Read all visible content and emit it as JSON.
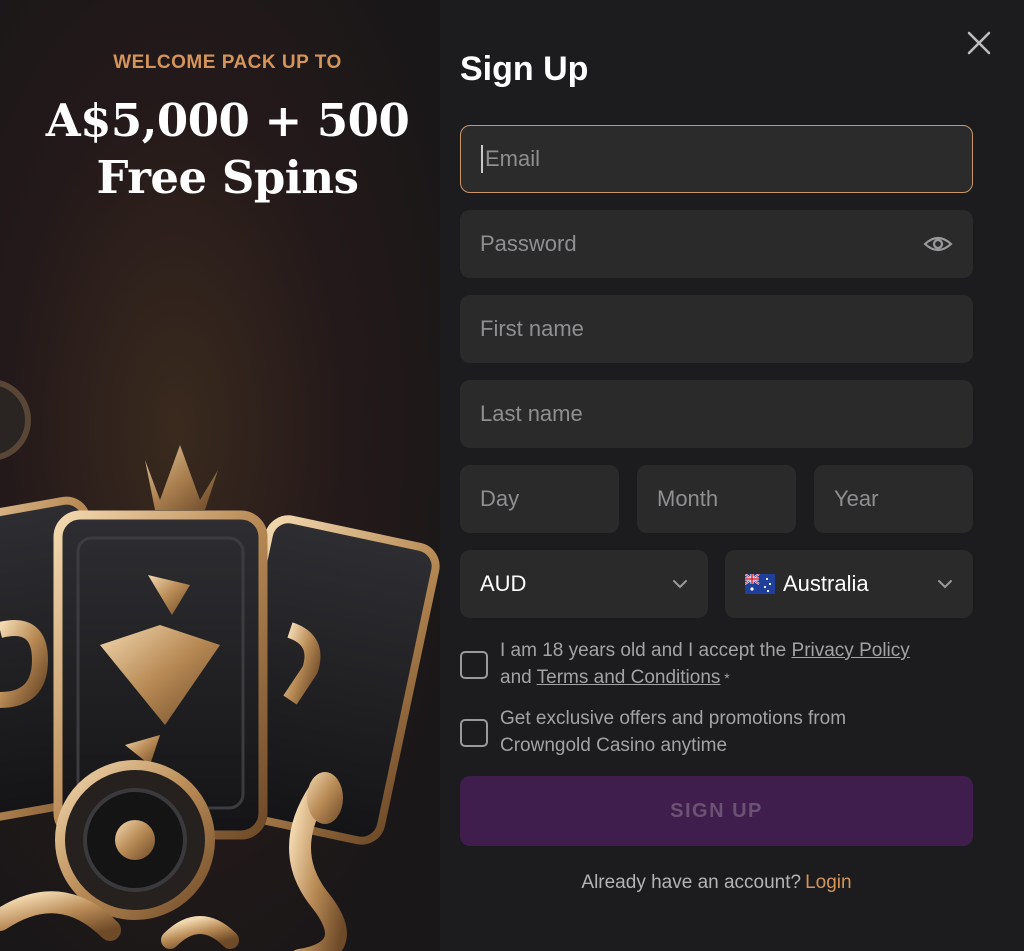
{
  "promo": {
    "kicker": "WELCOME PACK UP TO",
    "headline_line1": "A$5,000 + 500",
    "headline_line2": "Free Spins"
  },
  "form": {
    "title": "Sign Up",
    "email_placeholder": "Email",
    "password_placeholder": "Password",
    "first_name_placeholder": "First name",
    "last_name_placeholder": "Last name",
    "day_placeholder": "Day",
    "month_placeholder": "Month",
    "year_placeholder": "Year",
    "currency_value": "AUD",
    "country_value": "Australia",
    "age_text_1": "I am 18 years old and I accept the ",
    "privacy_link": "Privacy Policy",
    "age_text_2": "and ",
    "terms_link": "Terms and Conditions",
    "age_required": " *",
    "offers_text": "Get exclusive offers and promotions from Crowngold Casino anytime",
    "submit_label": "SIGN UP",
    "login_prompt": "Already have an account?",
    "login_link": "Login"
  },
  "icons": {
    "close": "close-icon",
    "eye": "eye-icon",
    "chevron": "chevron-down-icon",
    "flag": "australia-flag-icon"
  },
  "colors": {
    "accent": "#d4955a",
    "focus_border": "#c89668",
    "submit_bg": "#3f1e4e"
  }
}
